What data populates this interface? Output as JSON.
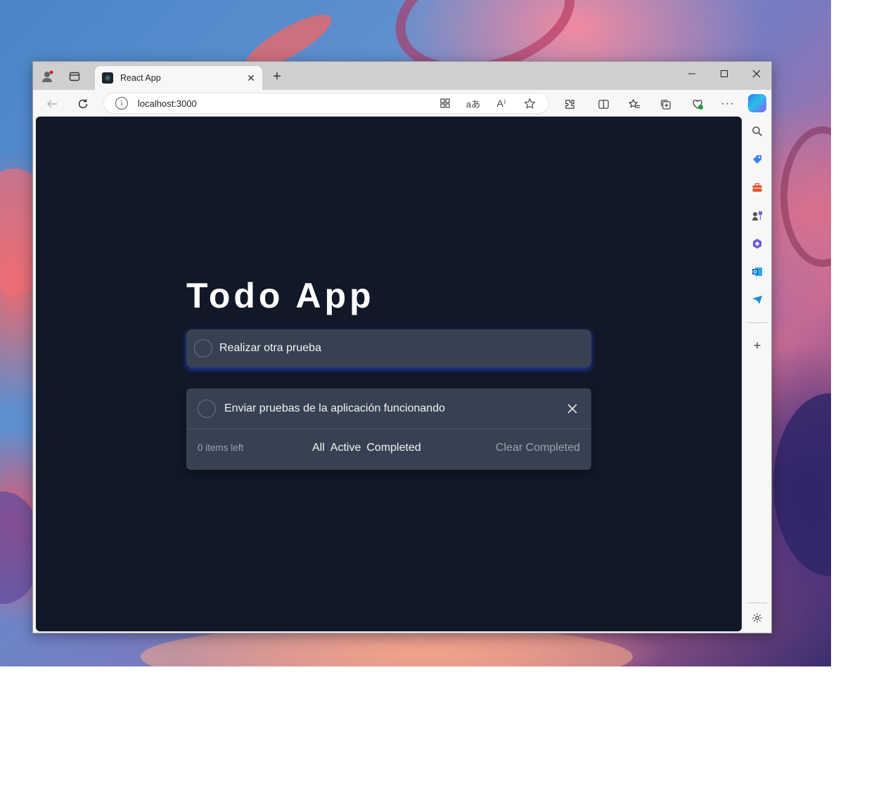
{
  "browser": {
    "tab_title": "React App",
    "address": "localhost:3000",
    "icons": {
      "profile": "profile-icon",
      "workspaces": "tab-actions-icon",
      "new_tab": "plus-icon",
      "minimize": "minimize-icon",
      "maximize": "maximize-icon",
      "close": "close-icon",
      "back": "back-arrow-icon",
      "refresh": "refresh-icon",
      "info": "info-icon",
      "app_available": "app-available-icon",
      "translate": "translate-icon",
      "read_aloud": "read-aloud-icon",
      "favorite": "star-icon",
      "extensions": "extensions-icon",
      "split_screen": "split-screen-icon",
      "favorites": "favorites-icon",
      "collections": "collections-icon",
      "browser_essentials": "browser-essentials-icon",
      "more": "more-icon",
      "copilot": "copilot-icon"
    }
  },
  "sidebar": {
    "icons": [
      "search-icon",
      "shopping-tag-icon",
      "tools-icon",
      "games-icon",
      "microsoft-365-icon",
      "outlook-icon",
      "telegram-icon",
      "add-icon",
      "settings-icon"
    ]
  },
  "app": {
    "title": "Todo App",
    "new_todo": "Realizar otra prueba",
    "todos": [
      {
        "text": "Enviar pruebas de la aplicación funcionando"
      }
    ],
    "footer": {
      "items_left": "0 items left",
      "filters": [
        "All",
        "Active",
        "Completed"
      ],
      "clear": "Clear Completed"
    }
  },
  "colors": {
    "page_background": "#111827",
    "card": "#374151",
    "accent_glow": "#2547e6"
  }
}
